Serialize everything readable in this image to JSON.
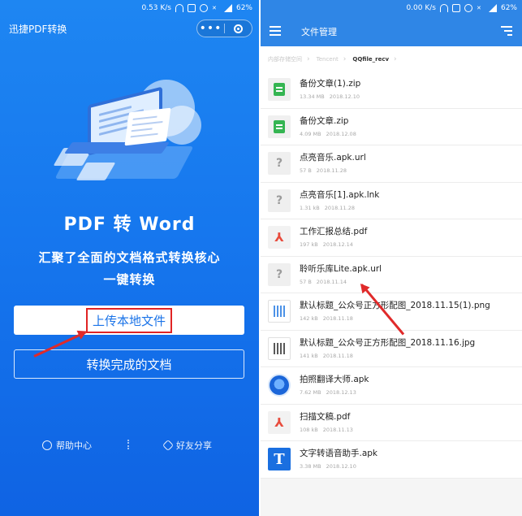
{
  "left": {
    "status": {
      "net": "0.53 K/s",
      "battery": "62%"
    },
    "app_title": "迅捷PDF转换",
    "capsule": {
      "more": "•••"
    },
    "headline": "PDF 转 Word",
    "subtitle_line1": "汇聚了全面的文档格式转换核心",
    "subtitle_line2": "一键转换",
    "upload_button": "上传本地文件",
    "done_button": "转换完成的文档",
    "footer": {
      "help": "帮助中心",
      "share": "好友分享"
    }
  },
  "right": {
    "status": {
      "net": "0.00 K/s",
      "battery": "62%"
    },
    "title": "文件管理",
    "breadcrumb": [
      "内部存储空间",
      "Tencent",
      "QQfile_recv"
    ],
    "files": [
      {
        "name": "备份文章(1).zip",
        "size": "13.34 MB",
        "date": "2018.12.10",
        "icon": "zip-icon"
      },
      {
        "name": "备份文章.zip",
        "size": "4.09 MB",
        "date": "2018.12.08",
        "icon": "zip-icon"
      },
      {
        "name": "点亮音乐.apk.url",
        "size": "57 B",
        "date": "2018.11.28",
        "icon": "unknown-file-icon"
      },
      {
        "name": "点亮音乐[1].apk.lnk",
        "size": "1.31 kB",
        "date": "2018.11.28",
        "icon": "unknown-file-icon"
      },
      {
        "name": "工作汇报总结.pdf",
        "size": "197 kB",
        "date": "2018.12.14",
        "icon": "pdf-icon"
      },
      {
        "name": "聆听乐库Lite.apk.url",
        "size": "57 B",
        "date": "2018.11.14",
        "icon": "unknown-file-icon"
      },
      {
        "name": "默认标题_公众号正方形配图_2018.11.15(1).png",
        "size": "142 kB",
        "date": "2018.11.18",
        "icon": "image-thumb-icon"
      },
      {
        "name": "默认标题_公众号正方形配图_2018.11.16.jpg",
        "size": "141 kB",
        "date": "2018.11.18",
        "icon": "image-thumb-icon"
      },
      {
        "name": "拍照翻译大师.apk",
        "size": "7.62 MB",
        "date": "2018.12.13",
        "icon": "app-round-icon"
      },
      {
        "name": "扫描文稿.pdf",
        "size": "108 kB",
        "date": "2018.11.13",
        "icon": "pdf-icon"
      },
      {
        "name": "文字转语音助手.apk",
        "size": "3.38 MB",
        "date": "2018.12.10",
        "icon": "app-t-icon"
      }
    ]
  }
}
